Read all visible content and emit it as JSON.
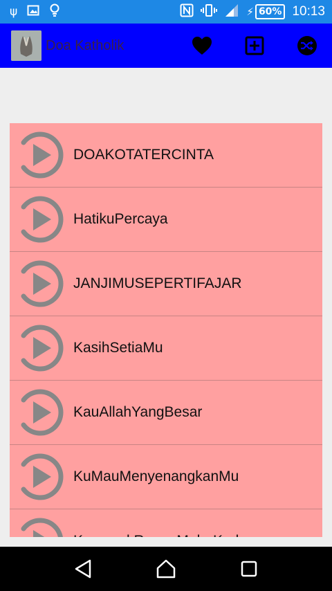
{
  "status_bar": {
    "battery_percent": "60%",
    "time": "10:13"
  },
  "app_bar": {
    "title": "Doa Katholik",
    "actions": [
      "heart-icon",
      "add-box-icon",
      "shuffle-icon"
    ]
  },
  "songs": [
    "DOAKOTATERCINTA",
    "HatikuPercaya",
    "JANJIMUSEPERTIFAJAR",
    "KasihSetiaMu",
    "KauAllahYangBesar",
    "KuMauMenyenangkanMu",
    "KumasukRuangMahaKudus"
  ],
  "colors": {
    "status_bar": "#1e88e5",
    "app_bar": "#0000ff",
    "list_bg": "#ffa0a0",
    "play_icon": "#878787"
  }
}
